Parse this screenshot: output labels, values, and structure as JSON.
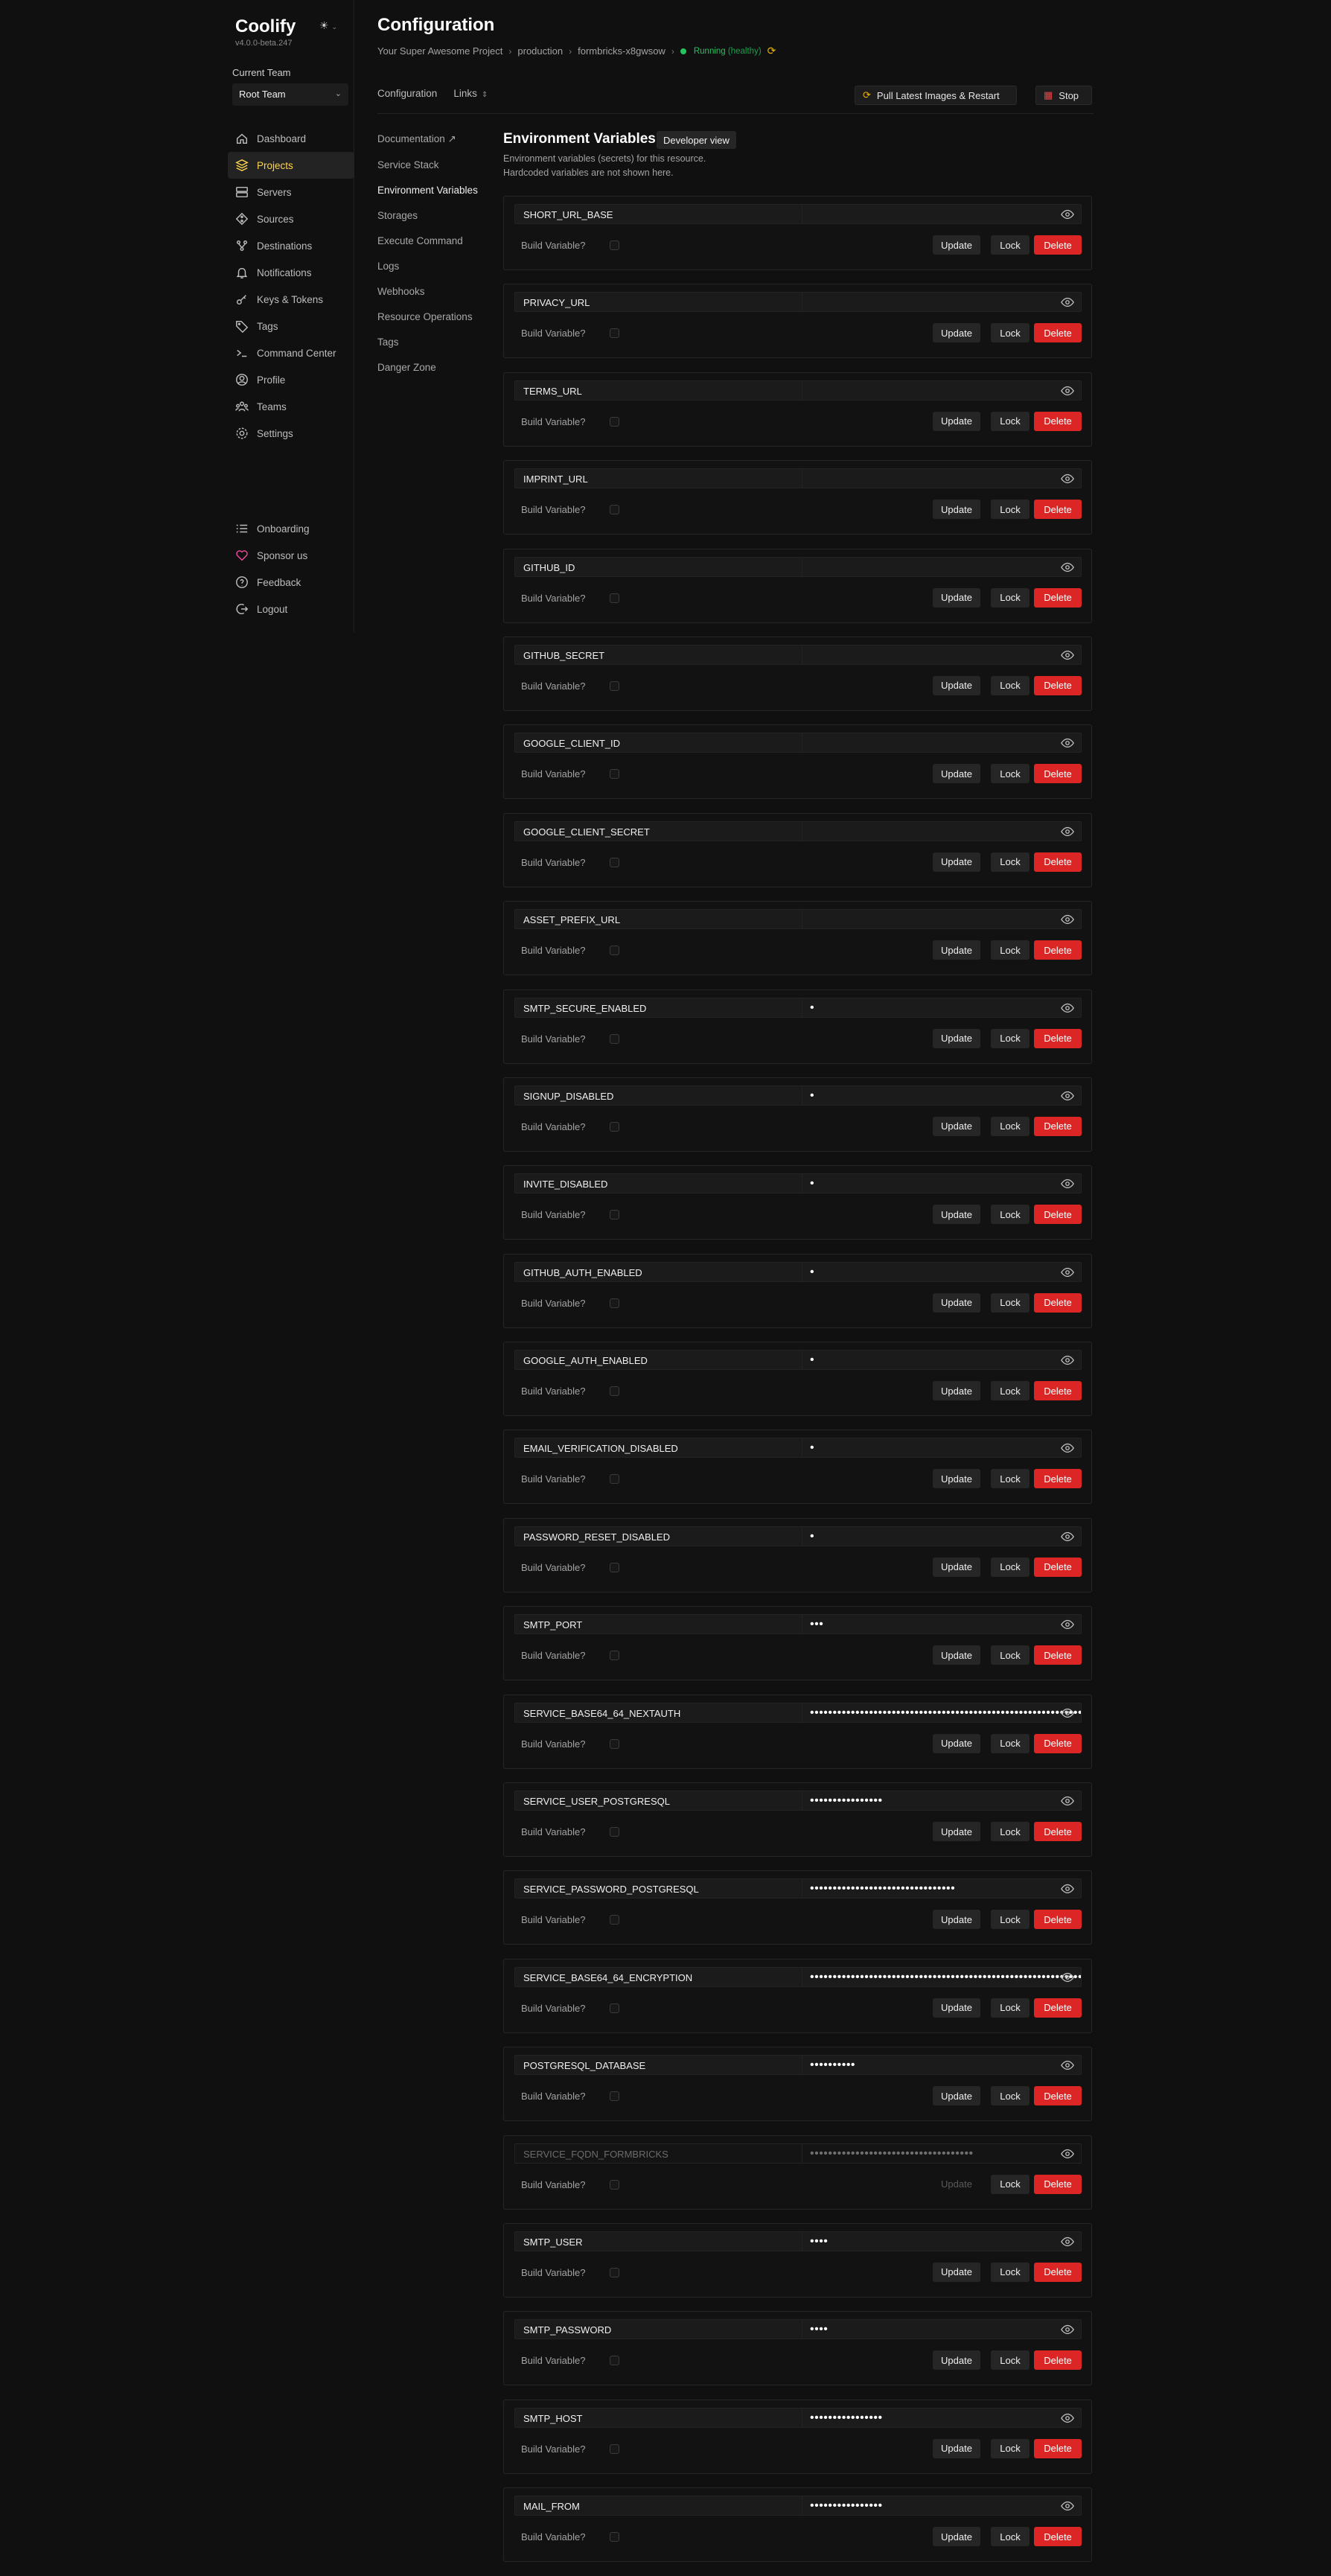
{
  "app": {
    "name": "Coolify",
    "version": "v4.0.0-beta.247"
  },
  "team": {
    "label": "Current Team",
    "selected": "Root Team"
  },
  "nav": {
    "items": [
      {
        "label": "Dashboard",
        "icon": "home-icon"
      },
      {
        "label": "Projects",
        "icon": "layers-icon",
        "active": true
      },
      {
        "label": "Servers",
        "icon": "server-icon"
      },
      {
        "label": "Sources",
        "icon": "git-icon"
      },
      {
        "label": "Destinations",
        "icon": "network-icon"
      },
      {
        "label": "Notifications",
        "icon": "bell-icon"
      },
      {
        "label": "Keys & Tokens",
        "icon": "key-icon"
      },
      {
        "label": "Tags",
        "icon": "tag-icon"
      },
      {
        "label": "Command Center",
        "icon": "terminal-icon"
      },
      {
        "label": "Profile",
        "icon": "user-icon"
      },
      {
        "label": "Teams",
        "icon": "users-icon"
      },
      {
        "label": "Settings",
        "icon": "gear-icon"
      }
    ],
    "bottom": [
      {
        "label": "Onboarding",
        "icon": "list-icon"
      },
      {
        "label": "Sponsor us",
        "icon": "heart-icon"
      },
      {
        "label": "Feedback",
        "icon": "help-icon"
      },
      {
        "label": "Logout",
        "icon": "logout-icon"
      }
    ]
  },
  "header": {
    "title": "Configuration",
    "breadcrumb": [
      "Your Super Awesome Project",
      "production",
      "formbricks-x8gwsow"
    ],
    "status": "Running",
    "status_sub": "(healthy)"
  },
  "tabs": {
    "configuration": "Configuration",
    "links": "Links"
  },
  "actions": {
    "pull": "Pull Latest Images & Restart",
    "stop": "Stop"
  },
  "subnav": [
    {
      "label": "Documentation ↗"
    },
    {
      "label": "Service Stack"
    },
    {
      "label": "Environment Variables",
      "active": true
    },
    {
      "label": "Storages"
    },
    {
      "label": "Execute Command"
    },
    {
      "label": "Logs"
    },
    {
      "label": "Webhooks"
    },
    {
      "label": "Resource Operations"
    },
    {
      "label": "Tags"
    },
    {
      "label": "Danger Zone"
    }
  ],
  "env": {
    "title": "Environment Variables",
    "dev_view": "Developer view",
    "desc1": "Environment variables (secrets) for this resource.",
    "desc2": "Hardcoded variables are not shown here.",
    "build_label": "Build Variable?",
    "update_label": "Update",
    "lock_label": "Lock",
    "delete_label": "Delete",
    "variables": [
      {
        "key": "SHORT_URL_BASE",
        "value": ""
      },
      {
        "key": "PRIVACY_URL",
        "value": ""
      },
      {
        "key": "TERMS_URL",
        "value": ""
      },
      {
        "key": "IMPRINT_URL",
        "value": ""
      },
      {
        "key": "GITHUB_ID",
        "value": ""
      },
      {
        "key": "GITHUB_SECRET",
        "value": ""
      },
      {
        "key": "GOOGLE_CLIENT_ID",
        "value": ""
      },
      {
        "key": "GOOGLE_CLIENT_SECRET",
        "value": ""
      },
      {
        "key": "ASSET_PREFIX_URL",
        "value": ""
      },
      {
        "key": "SMTP_SECURE_ENABLED",
        "value": "•"
      },
      {
        "key": "SIGNUP_DISABLED",
        "value": "•"
      },
      {
        "key": "INVITE_DISABLED",
        "value": "•"
      },
      {
        "key": "GITHUB_AUTH_ENABLED",
        "value": "•"
      },
      {
        "key": "GOOGLE_AUTH_ENABLED",
        "value": "•"
      },
      {
        "key": "EMAIL_VERIFICATION_DISABLED",
        "value": "•"
      },
      {
        "key": "PASSWORD_RESET_DISABLED",
        "value": "•"
      },
      {
        "key": "SMTP_PORT",
        "value": "•••"
      },
      {
        "key": "SERVICE_BASE64_64_NEXTAUTH",
        "value": "••••••••••••••••••••••••••••••••••••••••••••••••••••••••••••••••"
      },
      {
        "key": "SERVICE_USER_POSTGRESQL",
        "value": "••••••••••••••••"
      },
      {
        "key": "SERVICE_PASSWORD_POSTGRESQL",
        "value": "••••••••••••••••••••••••••••••••"
      },
      {
        "key": "SERVICE_BASE64_64_ENCRYPTION",
        "value": "••••••••••••••••••••••••••••••••••••••••••••••••••••••••••••••••"
      },
      {
        "key": "POSTGRESQL_DATABASE",
        "value": "••••••••••"
      },
      {
        "key": "SERVICE_FQDN_FORMBRICKS",
        "value": "••••••••••••••••••••••••••••••••••••",
        "readonly": true
      },
      {
        "key": "SMTP_USER",
        "value": "••••"
      },
      {
        "key": "SMTP_PASSWORD",
        "value": "••••"
      },
      {
        "key": "SMTP_HOST",
        "value": "••••••••••••••••"
      },
      {
        "key": "MAIL_FROM",
        "value": "••••••••••••••••"
      }
    ]
  }
}
